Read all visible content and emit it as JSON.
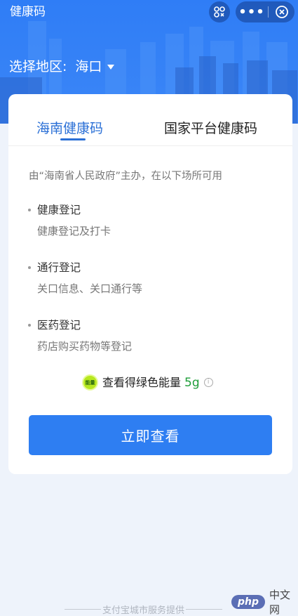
{
  "window": {
    "title": "健康码"
  },
  "capsule": {
    "more_label": "•••"
  },
  "region": {
    "label": "选择地区:",
    "value": "海口"
  },
  "tabs": [
    {
      "label": "海南健康码",
      "active": true
    },
    {
      "label": "国家平台健康码",
      "active": false
    }
  ],
  "description": "由“海南省人民政府”主办，在以下场所可用",
  "items": [
    {
      "title": "健康登记",
      "sub": "健康登记及打卡"
    },
    {
      "title": "通行登记",
      "sub": "关口信息、关口通行等"
    },
    {
      "title": "医药登记",
      "sub": "药店购买药物等登记"
    }
  ],
  "energy": {
    "badge": "能量",
    "label": "查看得绿色能量",
    "amount": "5g",
    "info_icon": "i"
  },
  "primary_button": {
    "label": "立即查看"
  },
  "footer": {
    "text": "支付宝城市服务提供"
  },
  "watermark": {
    "logo": "php",
    "text": "中文网"
  },
  "colors": {
    "brand_blue": "#2e7ef2",
    "energy_green": "#1e9e39"
  }
}
